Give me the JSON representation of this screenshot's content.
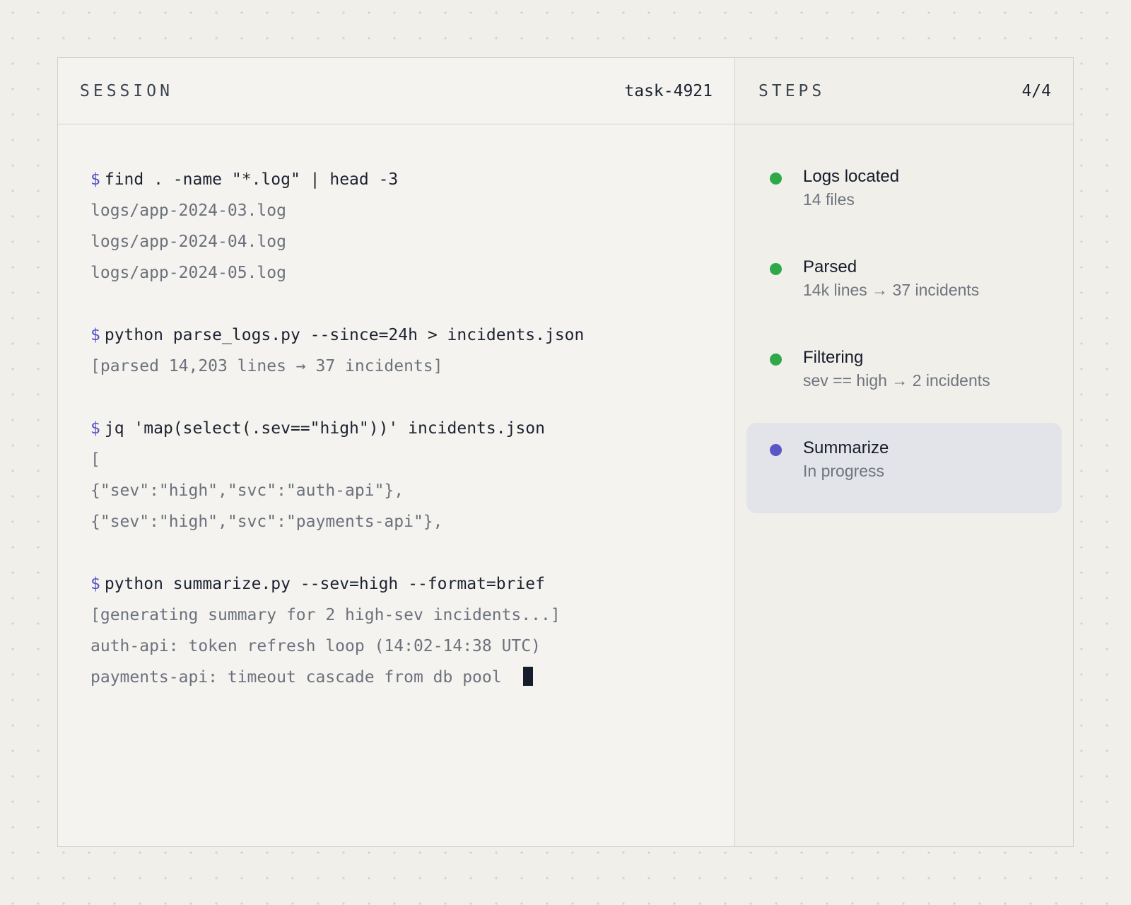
{
  "session": {
    "title": "SESSION",
    "task_id": "task-4921",
    "prompt_symbol": "$",
    "blocks": [
      {
        "command": "find . -name \"*.log\" | head -3",
        "output": [
          "logs/app-2024-03.log",
          "logs/app-2024-04.log",
          "logs/app-2024-05.log"
        ]
      },
      {
        "command": "python parse_logs.py --since=24h > incidents.json",
        "output": [
          "[parsed 14,203 lines → 37 incidents]"
        ]
      },
      {
        "command": "jq 'map(select(.sev==\"high\"))' incidents.json",
        "output": [
          "[",
          "{\"sev\":\"high\",\"svc\":\"auth-api\"},",
          "{\"sev\":\"high\",\"svc\":\"payments-api\"},"
        ]
      },
      {
        "command": "python summarize.py --sev=high --format=brief",
        "output": [
          "[generating summary for 2 high-sev incidents...]",
          "auth-api: token refresh loop (14:02-14:38 UTC)",
          "payments-api: timeout cascade from db pool"
        ]
      }
    ]
  },
  "steps": {
    "title": "STEPS",
    "count": "4/4",
    "items": [
      {
        "title": "Logs located",
        "detail": "14 files",
        "status": "done",
        "dot_color": "#2fa84a"
      },
      {
        "title": "Parsed",
        "detail": "14k lines → 37 incidents",
        "status": "done",
        "dot_color": "#2fa84a"
      },
      {
        "title": "Filtering",
        "detail": "sev == high → 2 incidents",
        "status": "done",
        "dot_color": "#2fa84a"
      },
      {
        "title": "Summarize",
        "detail": "In progress",
        "status": "active",
        "dot_color": "#5a56c6"
      }
    ]
  },
  "colors": {
    "accent": "#5250c8",
    "done": "#2fa84a",
    "active_bg": "#e3e4e9"
  }
}
